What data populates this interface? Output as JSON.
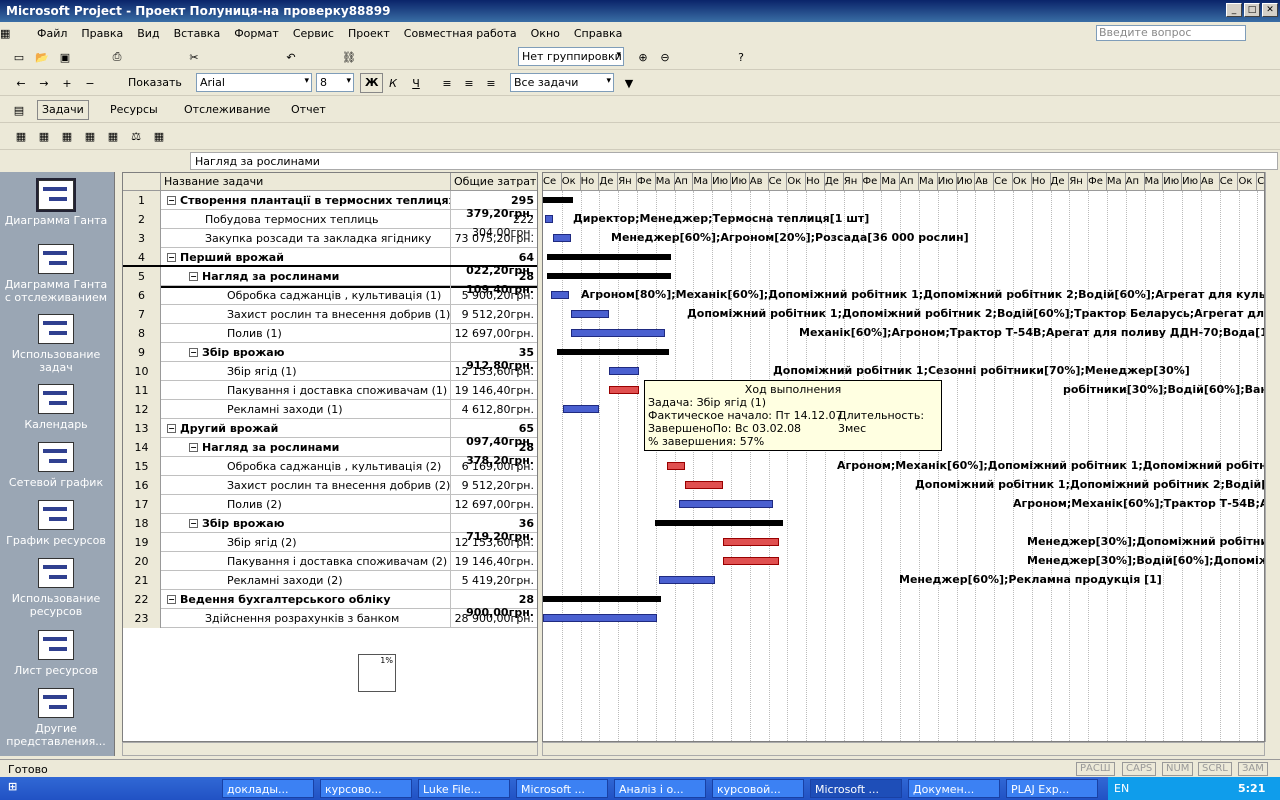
{
  "window": {
    "title": "Microsoft Project - Проект Полуниця-на проверку88899"
  },
  "menu": [
    "Файл",
    "Правка",
    "Вид",
    "Вставка",
    "Формат",
    "Сервис",
    "Проект",
    "Совместная работа",
    "Окно",
    "Справка"
  ],
  "help_placeholder": "Введите вопрос",
  "toolbar": {
    "grouping": "Нет группировки",
    "show": "Показать",
    "font": "Arial",
    "size": "8",
    "bold": "Ж",
    "italic": "К",
    "underline": "Ч",
    "filter": "Все задачи",
    "tasks": "Задачи",
    "resources": "Ресурсы",
    "tracking": "Отслеживание",
    "report": "Отчет"
  },
  "entry_value": "Нагляд за рослинами",
  "views": [
    "Диаграмма Ганта",
    "Диаграмма Ганта с отслеживанием",
    "Использование задач",
    "Календарь",
    "Сетевой график",
    "График ресурсов",
    "Использование ресурсов",
    "Лист ресурсов",
    "Другие представления..."
  ],
  "columns": {
    "name": "Название задачи",
    "cost": "Общие затраты"
  },
  "rows": [
    {
      "n": "1",
      "name": "Створення плантації  в термосних теплицях",
      "cost": "295 379,20грн.",
      "bold": true,
      "lvl": 0,
      "sum": true
    },
    {
      "n": "2",
      "name": "Побудова термосних теплиць",
      "cost": "222 304,00грн.",
      "lvl": 1
    },
    {
      "n": "3",
      "name": "Закупка розсади та закладка ягіднику",
      "cost": "73 075,20грн.",
      "lvl": 1
    },
    {
      "n": "4",
      "name": "Перший врожай",
      "cost": "64 022,20грн.",
      "bold": true,
      "lvl": 0,
      "sum": true
    },
    {
      "n": "5",
      "name": "Нагляд за рослинами",
      "cost": "28 109,40грн.",
      "bold": true,
      "lvl": 1,
      "sum": true
    },
    {
      "n": "6",
      "name": "Обробка саджанців , культивація (1)",
      "cost": "5 900,20грн.",
      "lvl": 2
    },
    {
      "n": "7",
      "name": "Захист рослин та внесення добрив (1)",
      "cost": "9 512,20грн.",
      "lvl": 2
    },
    {
      "n": "8",
      "name": "Полив  (1)",
      "cost": "12 697,00грн.",
      "lvl": 2
    },
    {
      "n": "9",
      "name": "Збір врожаю",
      "cost": "35 912,80грн.",
      "bold": true,
      "lvl": 1,
      "sum": true
    },
    {
      "n": "10",
      "name": "Збір ягід (1)",
      "cost": "12 153,60грн.",
      "lvl": 2
    },
    {
      "n": "11",
      "name": "Пакування  і доставка споживачам (1)",
      "cost": "19 146,40грн.",
      "lvl": 2
    },
    {
      "n": "12",
      "name": "Рекламні заходи (1)",
      "cost": "4 612,80грн.",
      "lvl": 2
    },
    {
      "n": "13",
      "name": "Другий врожай",
      "cost": "65 097,40грн.",
      "bold": true,
      "lvl": 0,
      "sum": true
    },
    {
      "n": "14",
      "name": "Нагляд за рослинами",
      "cost": "28 378,20грн.",
      "bold": true,
      "lvl": 1,
      "sum": true
    },
    {
      "n": "15",
      "name": "Обробка саджанців , культивація  (2)",
      "cost": "6 169,00грн.",
      "lvl": 2
    },
    {
      "n": "16",
      "name": "Захист рослин та внесення добрив  (2)",
      "cost": "9 512,20грн.",
      "lvl": 2
    },
    {
      "n": "17",
      "name": "Полив  (2)",
      "cost": "12 697,00грн.",
      "lvl": 2
    },
    {
      "n": "18",
      "name": "Збір врожаю",
      "cost": "36 719,20грн.",
      "bold": true,
      "lvl": 1,
      "sum": true
    },
    {
      "n": "19",
      "name": "Збір ягід  (2)",
      "cost": "12 153,60грн.",
      "lvl": 2
    },
    {
      "n": "20",
      "name": "Пакування  і доставка споживачам (2)",
      "cost": "19 146,40грн.",
      "lvl": 2
    },
    {
      "n": "21",
      "name": "Рекламні заходи  (2)",
      "cost": "5 419,20грн.",
      "lvl": 2
    },
    {
      "n": "22",
      "name": "Ведення бухгалтерського обліку",
      "cost": "28 900,00грн.",
      "bold": true,
      "lvl": 0,
      "sum": true
    },
    {
      "n": "23",
      "name": "Здійснення розрахунків з банком",
      "cost": "28 900,00грн.",
      "lvl": 1
    }
  ],
  "months": [
    "Се",
    "Ок",
    "Но",
    "Де",
    "Ян",
    "Фе",
    "Ма",
    "Ап",
    "Ма",
    "Ию",
    "Ию",
    "Ав",
    "Се",
    "Ок",
    "Но",
    "Де",
    "Ян",
    "Фе",
    "Ма",
    "Ап",
    "Ма",
    "Ию",
    "Ию",
    "Ав",
    "Се",
    "Ок",
    "Но",
    "Де",
    "Ян",
    "Фе",
    "Ма",
    "Ап",
    "Ма",
    "Ию",
    "Ию",
    "Ав",
    "Се",
    "Ок",
    "С"
  ],
  "bar_labels": [
    "",
    "Директор;Менеджер;Термосна теплиця[1 шт]",
    "Менеджер[60%];Агроном[20%];Розсада[36 000 рослин]",
    "",
    "",
    "Агроном[80%];Механік[60%];Допоміжний робітник 1;Допоміжний робітник 2;Водій[60%];Агрегат для культ. ПРВМ-3;Трактор",
    "Допоміжний робітник 1;Допоміжний робітник 2;Водій[60%];Трактор Беларусь;Агрегат для оприск.  ОН-400-5;Агрегат",
    "Механік[60%];Агроном;Трактор Т-54В;Арегат для поливу ДДН-70;Вода[1];Паливо-мастивні матеріали[275]",
    "",
    "Допоміжний робітник 1;Сезонні робітники[70%];Менеджер[30%]",
    "робітники[30%];Водій[60%];Вантажна машина;Тара-пакетн",
    "Менед",
    "",
    "",
    "Агроном;Механік[60%];Допоміжний робітник 1;Допоміжний робітник 2;Водій[60%];Трактор Т-54В;Агрег",
    "Допоміжний робітник 1;Допоміжний робітник 2;Водій[60%];Агрегат для оприск.  ОН-400-5;Агрега",
    "Агроном;Механік[60%];Трактор Т-54В;Арегат для поливу ДДН-70;Вода[1];Паливо-масти",
    "",
    "Менеджер[30%];Допоміжний робітник 1;Сезонні робітники[70%]",
    "Менеджер[30%];Водій[60%];Допоміжний робітник 2;Сезонні робітники[30%];Вантажна",
    "Менеджер[60%];Рекламна продукція [1]",
    "",
    ""
  ],
  "tooltip": {
    "title": "Ход выполнения",
    "l1": "Задача: Збір ягід (1)",
    "l2": "Фактическое начало: Пт 14.12.07",
    "l2b": "Длительность: 3мес",
    "l3": "ЗавершеноПо: Вс 03.02.08",
    "l4": "% завершения: 57%"
  },
  "pct_box": "1%",
  "status": {
    "ready": "Готово",
    "ind": [
      "РАСШ",
      "CAPS",
      "NUM",
      "SCRL",
      "ЗАМ"
    ]
  },
  "taskbar": [
    "доклады...",
    "курсово...",
    "Luke File...",
    "Microsoft ...",
    "Аналіз і о...",
    "курсовой...",
    "Microsoft ...",
    "Докумен...",
    "PLAJ Exp..."
  ],
  "tray": {
    "lang": "EN",
    "time": "5:21"
  }
}
